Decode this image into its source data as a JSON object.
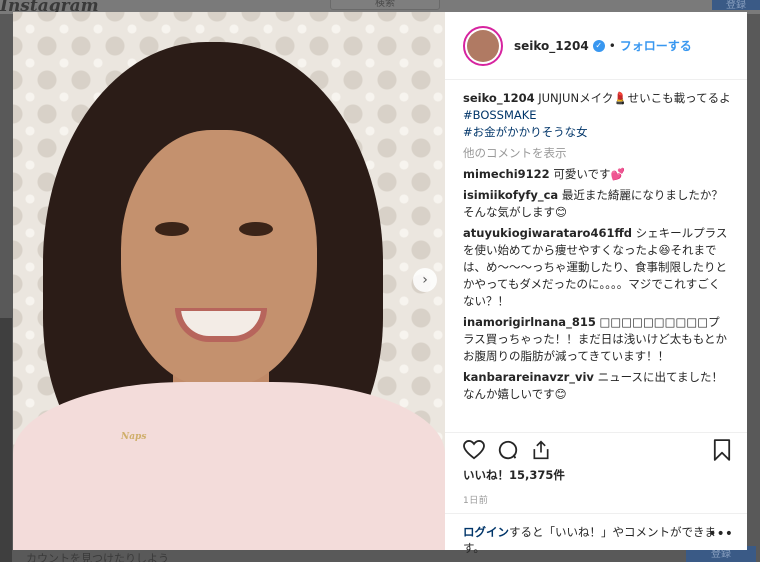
{
  "background": {
    "logo": "Instagram",
    "search_placeholder": "検索",
    "signup_top": "登録",
    "bottom_text": "カウントを見つけたりしよう",
    "bottom_button": "登録"
  },
  "post": {
    "username": "seiko_1204",
    "dot": "•",
    "follow_label": "フォローする",
    "necklace_text": "Naps",
    "caption": {
      "user": "seiko_1204",
      "text": "JUNJUNメイク💄せいこも載ってるよ",
      "tags": [
        "#BOSSMAKE",
        "#お金がかかりそうな女"
      ]
    },
    "load_more": "他のコメントを表示",
    "comments": [
      {
        "user": "mimechi9122",
        "text": "可愛いです💕"
      },
      {
        "user": "isimiikofyfy_ca",
        "text": "最近また綺麗になりましたか？そんな気がします😊"
      },
      {
        "user": "atuyukiogiwaratarо461ffd",
        "text": "シェキールプラスを使い始めてから痩せやすくなったよ😆それまでは、め〜〜〜っちゃ運動したり、食事制限したりとかやってもダメだったのに。。。。マジでこれすごくない？！"
      },
      {
        "user": "inamorigirlnana_815",
        "text": "□□□□□□□□□□プラス買っちゃった！！まだ日は浅いけど太ももとかお腹周りの脂肪が減ってきています！！"
      },
      {
        "user": "kanbarareinavzr_viv",
        "text": "ニュースに出てました！なんか嬉しいです😊"
      }
    ],
    "likes": "いいね！15,375件",
    "time": "1日前",
    "login_link": "ログイン",
    "login_text": "すると「いいね！」やコメントができます。",
    "more_options": "•••"
  },
  "colors": {
    "link_blue": "#3897f0",
    "tag_blue": "#003569",
    "overlay": "#595959"
  },
  "icons": [
    "heart-icon",
    "comment-icon",
    "share-icon",
    "bookmark-icon",
    "verified-badge-icon",
    "chevron-right-icon"
  ]
}
